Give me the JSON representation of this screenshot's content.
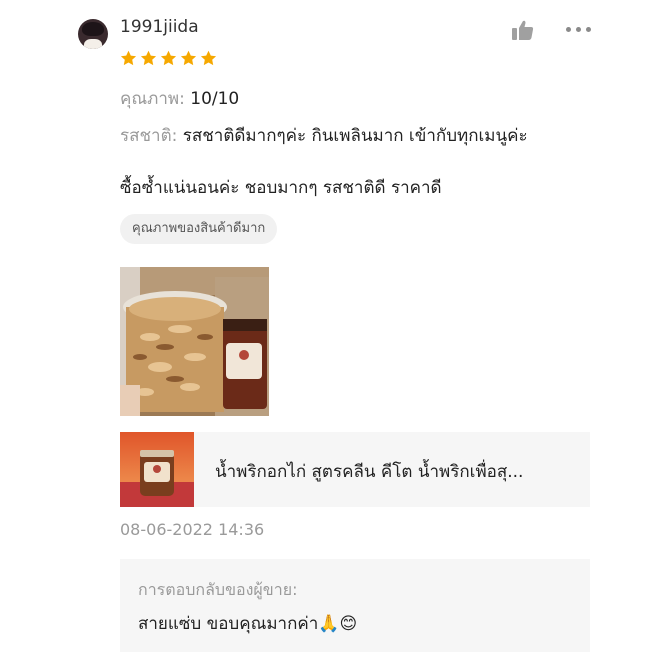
{
  "review": {
    "username": "1991jiida",
    "rating": 5,
    "rating_max": 5,
    "star_color": "#f6a800",
    "attributes": [
      {
        "label": "คุณภาพ:",
        "value": "10/10"
      },
      {
        "label": "รสชาติ:",
        "value": "รสชาติดีมากๆค่ะ กินเพลินมาก เข้ากับทุกเมนูค่ะ"
      }
    ],
    "comment": "ซื้อซ้ำแน่นอนค่ะ ชอบมากๆ รสชาติดี ราคาดี",
    "tag": "คุณภาพของสินค้าดีมาก",
    "timestamp": "08-06-2022 14:36"
  },
  "product": {
    "title": "น้ำพริกอกไก่ สูตรคลีน คีโต น้ำพริกเพื่อสุ..."
  },
  "seller_reply": {
    "label": "การตอบกลับของผู้ขาย:",
    "text": "สายแซ่บ ขอบคุณมากค่า🙏😊"
  },
  "icons": {
    "like": "thumbs-up-icon",
    "more": "more-options-icon"
  }
}
